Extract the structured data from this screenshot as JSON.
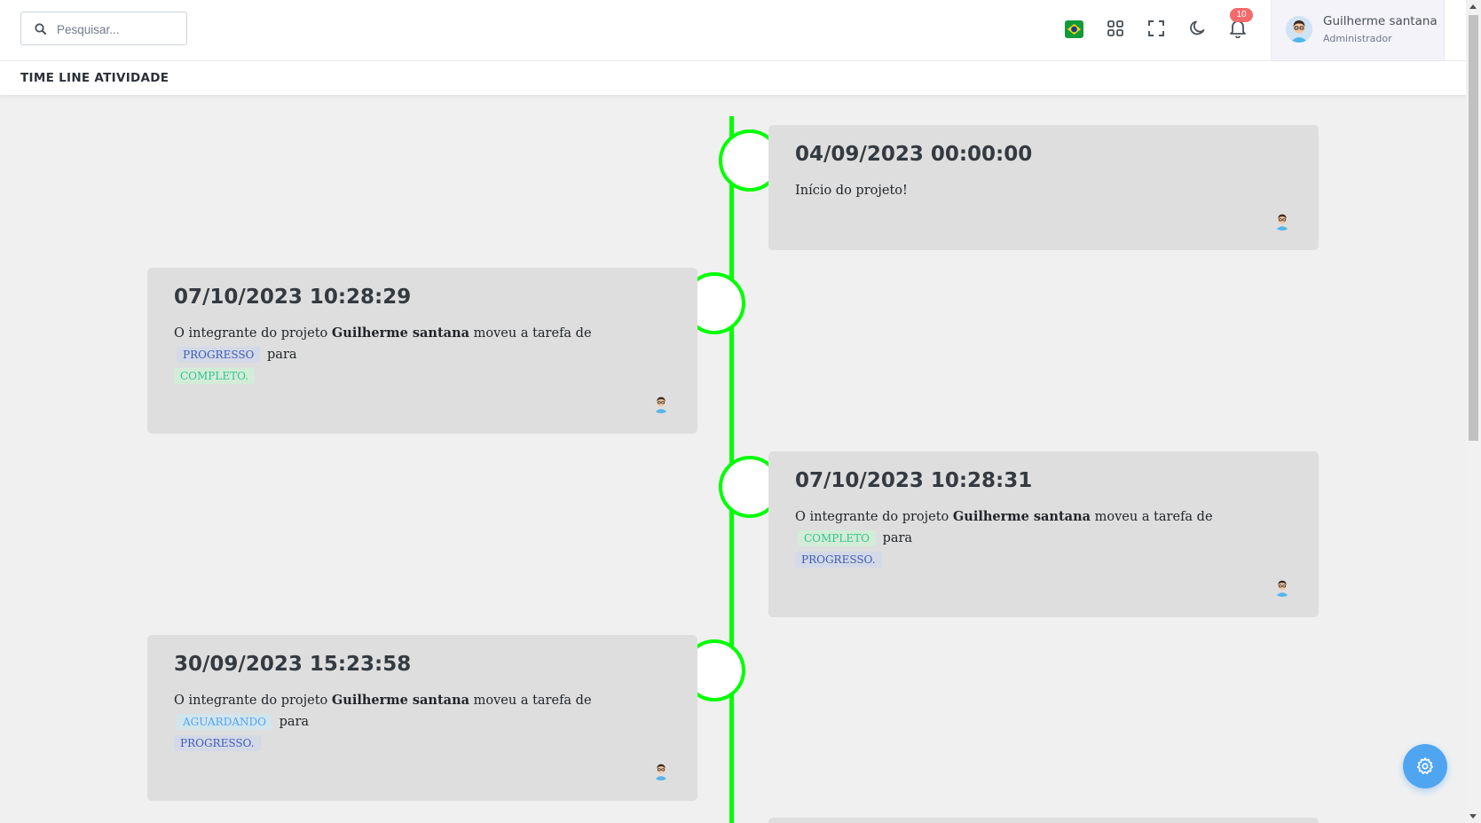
{
  "header": {
    "search_placeholder": "Pesquisar...",
    "language_flag": "brazil-flag-icon",
    "notification_count": "10",
    "user": {
      "name": "Guilherme santana",
      "role": "Administrador"
    }
  },
  "page": {
    "title": "TIME LINE ATIVIDADE"
  },
  "timeline": [
    {
      "date": "04/09/2023 00:00:00",
      "text": "Início do projeto!"
    },
    {
      "date": "07/10/2023 10:28:29",
      "prefix": "O integrante do projeto",
      "member": "Guilherme santana",
      "middle": "moveu a tarefa de",
      "from": "PROGRESSO",
      "connector": "para",
      "to": "COMPLETO."
    },
    {
      "date": "07/10/2023 10:28:31",
      "prefix": "O integrante do projeto",
      "member": "Guilherme santana",
      "middle": "moveu a tarefa de",
      "from": "COMPLETO",
      "connector": "para",
      "to": "PROGRESSO."
    },
    {
      "date": "30/09/2023 15:23:58",
      "prefix": "O integrante do projeto",
      "member": "Guilherme santana",
      "middle": "moveu a tarefa de",
      "from": "AGUARDANDO",
      "connector": "para",
      "to": "PROGRESSO."
    }
  ],
  "colors": {
    "timeline_line": "#00ff00",
    "card_bg": "#dedede",
    "tag_progress": "#3b5bb5",
    "tag_complete": "#34c38f",
    "tag_waiting": "#50a5f1",
    "notification_badge": "#f46a6a",
    "settings_fab": "#50a5f1"
  }
}
